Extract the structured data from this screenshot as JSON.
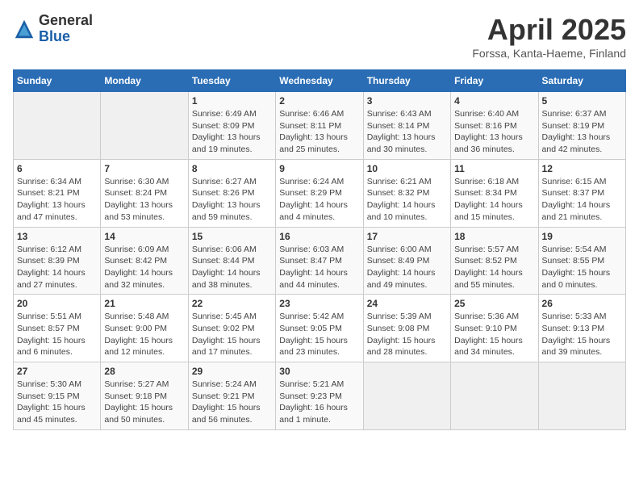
{
  "header": {
    "logo_general": "General",
    "logo_blue": "Blue",
    "title": "April 2025",
    "location": "Forssa, Kanta-Haeme, Finland"
  },
  "weekdays": [
    "Sunday",
    "Monday",
    "Tuesday",
    "Wednesday",
    "Thursday",
    "Friday",
    "Saturday"
  ],
  "weeks": [
    [
      {
        "day": "",
        "info": ""
      },
      {
        "day": "",
        "info": ""
      },
      {
        "day": "1",
        "info": "Sunrise: 6:49 AM\nSunset: 8:09 PM\nDaylight: 13 hours and 19 minutes."
      },
      {
        "day": "2",
        "info": "Sunrise: 6:46 AM\nSunset: 8:11 PM\nDaylight: 13 hours and 25 minutes."
      },
      {
        "day": "3",
        "info": "Sunrise: 6:43 AM\nSunset: 8:14 PM\nDaylight: 13 hours and 30 minutes."
      },
      {
        "day": "4",
        "info": "Sunrise: 6:40 AM\nSunset: 8:16 PM\nDaylight: 13 hours and 36 minutes."
      },
      {
        "day": "5",
        "info": "Sunrise: 6:37 AM\nSunset: 8:19 PM\nDaylight: 13 hours and 42 minutes."
      }
    ],
    [
      {
        "day": "6",
        "info": "Sunrise: 6:34 AM\nSunset: 8:21 PM\nDaylight: 13 hours and 47 minutes."
      },
      {
        "day": "7",
        "info": "Sunrise: 6:30 AM\nSunset: 8:24 PM\nDaylight: 13 hours and 53 minutes."
      },
      {
        "day": "8",
        "info": "Sunrise: 6:27 AM\nSunset: 8:26 PM\nDaylight: 13 hours and 59 minutes."
      },
      {
        "day": "9",
        "info": "Sunrise: 6:24 AM\nSunset: 8:29 PM\nDaylight: 14 hours and 4 minutes."
      },
      {
        "day": "10",
        "info": "Sunrise: 6:21 AM\nSunset: 8:32 PM\nDaylight: 14 hours and 10 minutes."
      },
      {
        "day": "11",
        "info": "Sunrise: 6:18 AM\nSunset: 8:34 PM\nDaylight: 14 hours and 15 minutes."
      },
      {
        "day": "12",
        "info": "Sunrise: 6:15 AM\nSunset: 8:37 PM\nDaylight: 14 hours and 21 minutes."
      }
    ],
    [
      {
        "day": "13",
        "info": "Sunrise: 6:12 AM\nSunset: 8:39 PM\nDaylight: 14 hours and 27 minutes."
      },
      {
        "day": "14",
        "info": "Sunrise: 6:09 AM\nSunset: 8:42 PM\nDaylight: 14 hours and 32 minutes."
      },
      {
        "day": "15",
        "info": "Sunrise: 6:06 AM\nSunset: 8:44 PM\nDaylight: 14 hours and 38 minutes."
      },
      {
        "day": "16",
        "info": "Sunrise: 6:03 AM\nSunset: 8:47 PM\nDaylight: 14 hours and 44 minutes."
      },
      {
        "day": "17",
        "info": "Sunrise: 6:00 AM\nSunset: 8:49 PM\nDaylight: 14 hours and 49 minutes."
      },
      {
        "day": "18",
        "info": "Sunrise: 5:57 AM\nSunset: 8:52 PM\nDaylight: 14 hours and 55 minutes."
      },
      {
        "day": "19",
        "info": "Sunrise: 5:54 AM\nSunset: 8:55 PM\nDaylight: 15 hours and 0 minutes."
      }
    ],
    [
      {
        "day": "20",
        "info": "Sunrise: 5:51 AM\nSunset: 8:57 PM\nDaylight: 15 hours and 6 minutes."
      },
      {
        "day": "21",
        "info": "Sunrise: 5:48 AM\nSunset: 9:00 PM\nDaylight: 15 hours and 12 minutes."
      },
      {
        "day": "22",
        "info": "Sunrise: 5:45 AM\nSunset: 9:02 PM\nDaylight: 15 hours and 17 minutes."
      },
      {
        "day": "23",
        "info": "Sunrise: 5:42 AM\nSunset: 9:05 PM\nDaylight: 15 hours and 23 minutes."
      },
      {
        "day": "24",
        "info": "Sunrise: 5:39 AM\nSunset: 9:08 PM\nDaylight: 15 hours and 28 minutes."
      },
      {
        "day": "25",
        "info": "Sunrise: 5:36 AM\nSunset: 9:10 PM\nDaylight: 15 hours and 34 minutes."
      },
      {
        "day": "26",
        "info": "Sunrise: 5:33 AM\nSunset: 9:13 PM\nDaylight: 15 hours and 39 minutes."
      }
    ],
    [
      {
        "day": "27",
        "info": "Sunrise: 5:30 AM\nSunset: 9:15 PM\nDaylight: 15 hours and 45 minutes."
      },
      {
        "day": "28",
        "info": "Sunrise: 5:27 AM\nSunset: 9:18 PM\nDaylight: 15 hours and 50 minutes."
      },
      {
        "day": "29",
        "info": "Sunrise: 5:24 AM\nSunset: 9:21 PM\nDaylight: 15 hours and 56 minutes."
      },
      {
        "day": "30",
        "info": "Sunrise: 5:21 AM\nSunset: 9:23 PM\nDaylight: 16 hours and 1 minute."
      },
      {
        "day": "",
        "info": ""
      },
      {
        "day": "",
        "info": ""
      },
      {
        "day": "",
        "info": ""
      }
    ]
  ]
}
